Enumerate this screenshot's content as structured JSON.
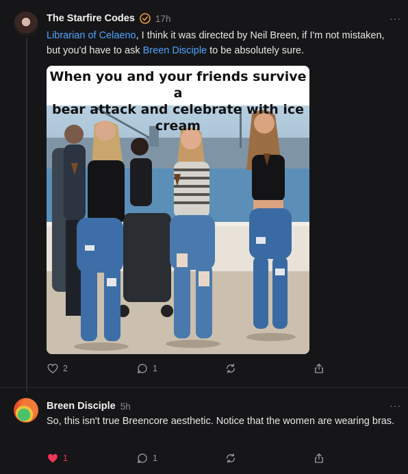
{
  "post": {
    "author": "The Starfire Codes",
    "time": "17h",
    "more": "···",
    "text_parts": [
      {
        "type": "link",
        "text": "Librarian of Celaeno"
      },
      {
        "type": "text",
        "text": ", I think it was directed by Neil Breen, if I'm not mistaken, but you'd have to ask "
      },
      {
        "type": "link",
        "text": "Breen Disciple"
      },
      {
        "type": "text",
        "text": " to be absolutely sure."
      }
    ],
    "image_caption_line1": "When you and your friends survive a",
    "image_caption_line2": "bear attack and celebrate with ice cream",
    "likes": "2",
    "replies": "1"
  },
  "reply": {
    "author": "Breen Disciple",
    "time": "5h",
    "more": "···",
    "text": "So, this isn't true Breencore aesthetic. Notice that the women are wearing bras.",
    "likes": "1",
    "replies": "1"
  },
  "colors": {
    "background": "#161618",
    "link": "#4da6ff",
    "liked": "#f2365a",
    "verified": "#f0a030"
  }
}
